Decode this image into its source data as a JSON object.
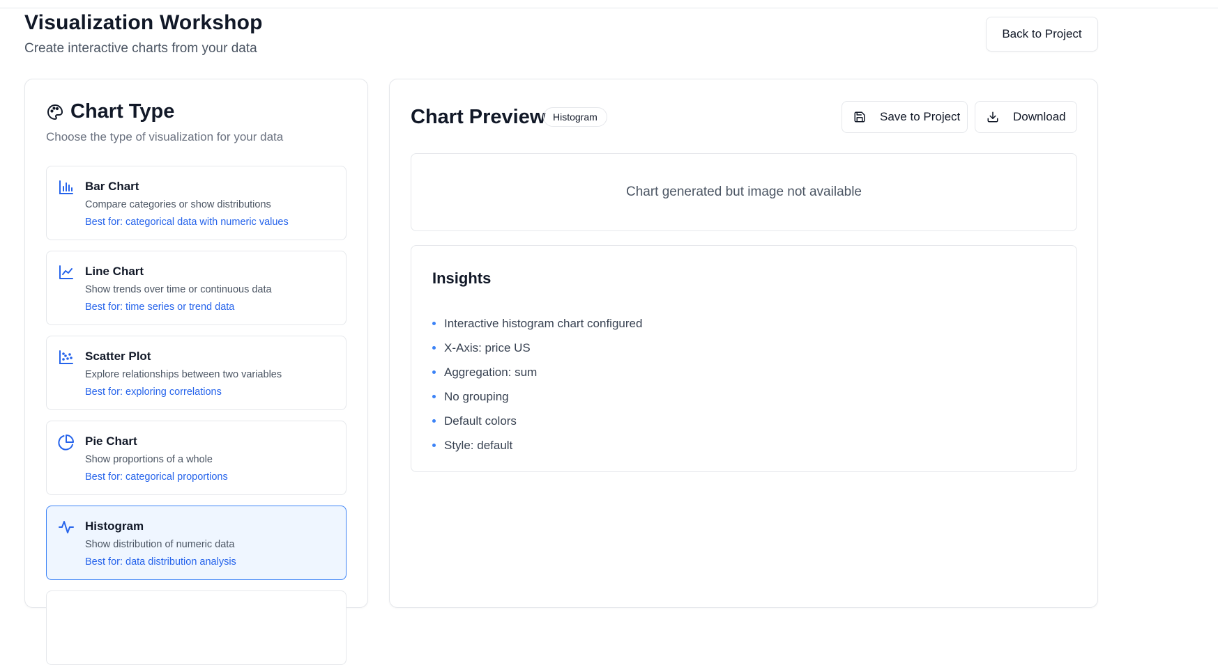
{
  "header": {
    "title": "Visualization Workshop",
    "subtitle": "Create interactive charts from your data",
    "back_label": "Back to Project"
  },
  "chart_type_panel": {
    "title": "Chart Type",
    "description": "Choose the type of visualization for your data",
    "items": [
      {
        "label": "Bar Chart",
        "description": "Compare categories or show distributions",
        "best_for": "Best for: categorical data with numeric values",
        "icon": "bar-chart-icon",
        "selected": false
      },
      {
        "label": "Line Chart",
        "description": "Show trends over time or continuous data",
        "best_for": "Best for: time series or trend data",
        "icon": "line-chart-icon",
        "selected": false
      },
      {
        "label": "Scatter Plot",
        "description": "Explore relationships between two variables",
        "best_for": "Best for: exploring correlations",
        "icon": "scatter-plot-icon",
        "selected": false
      },
      {
        "label": "Pie Chart",
        "description": "Show proportions of a whole",
        "best_for": "Best for: categorical proportions",
        "icon": "pie-chart-icon",
        "selected": false
      },
      {
        "label": "Histogram",
        "description": "Show distribution of numeric data",
        "best_for": "Best for: data distribution analysis",
        "icon": "histogram-icon",
        "selected": true
      }
    ]
  },
  "preview": {
    "title": "Chart Preview",
    "badge": "Histogram",
    "save_label": "Save to Project",
    "download_label": "Download",
    "image_message": "Chart generated but image not available",
    "insights_title": "Insights",
    "insights": [
      "Interactive histogram chart configured",
      "X-Axis: price US",
      "Aggregation: sum",
      "No grouping",
      "Default colors",
      "Style: default"
    ]
  },
  "colors": {
    "accent": "#2563eb",
    "selected_bg": "#eff6ff",
    "selected_border": "#3b82f6",
    "border": "#e5e7eb"
  }
}
